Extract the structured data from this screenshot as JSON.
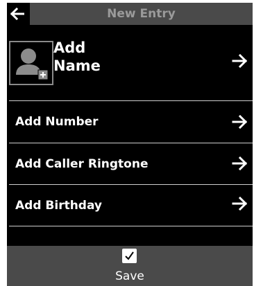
{
  "header": {
    "title": "New Entry",
    "back_icon": "arrow-left-icon"
  },
  "name_row": {
    "label": "Add\nName",
    "avatar_icon": "add-contact-avatar-icon",
    "arrow_icon": "arrow-right-icon"
  },
  "items": [
    {
      "label": "Add Number",
      "arrow_icon": "arrow-right-icon"
    },
    {
      "label": "Add Caller Ringtone",
      "arrow_icon": "arrow-right-icon"
    },
    {
      "label": "Add Birthday",
      "arrow_icon": "arrow-right-icon"
    }
  ],
  "footer": {
    "check_icon": "checkmark-icon",
    "save_label": "Save"
  },
  "colors": {
    "background": "#000000",
    "bar": "#4a4a4a",
    "title_text": "#9a9a9a",
    "text": "#ffffff",
    "divider": "#cfcfcf"
  }
}
